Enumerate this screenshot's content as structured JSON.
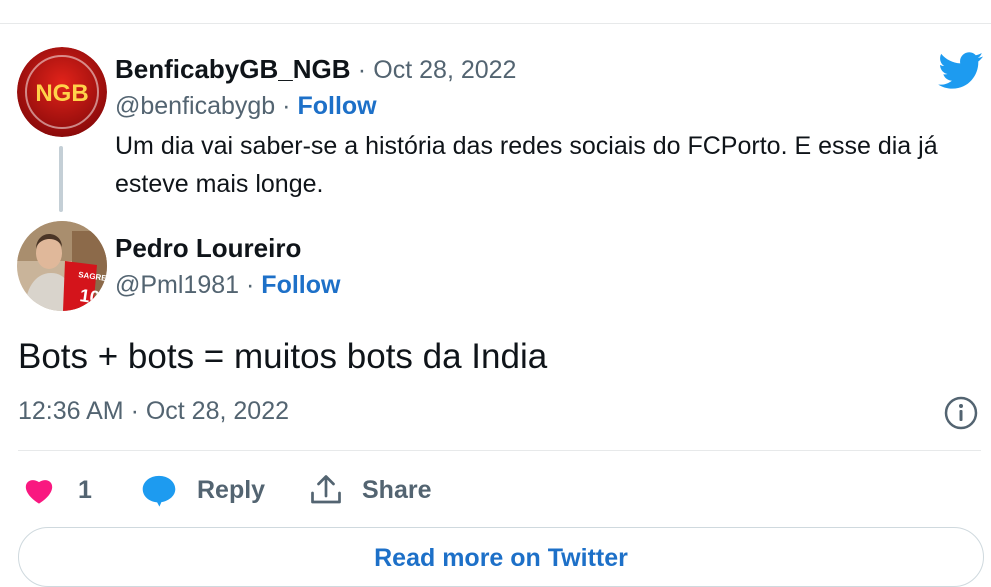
{
  "tweet_parent": {
    "author_name": "BenficabyGB_NGB",
    "separator": "·",
    "date": "Oct 28, 2022",
    "handle": "@benficabygb",
    "follow_label": "Follow",
    "text": "Um dia vai saber-se a história das redes sociais do FCPorto. E esse dia já esteve mais longe.",
    "avatar_logo_text": "NGB"
  },
  "tweet_main": {
    "author_name": "Pedro Loureiro",
    "handle": "@Pml1981",
    "separator": "·",
    "follow_label": "Follow",
    "text": "Bots + bots = muitos bots da India",
    "timestamp": "12:36 AM · Oct 28, 2022"
  },
  "actions": {
    "like_count": "1",
    "reply_label": "Reply",
    "share_label": "Share"
  },
  "footer": {
    "read_more_label": "Read more on Twitter"
  },
  "icons": {
    "brand": "twitter-bird-icon",
    "info": "info-icon",
    "like": "heart-icon",
    "reply": "speech-bubble-icon",
    "share": "share-upload-icon"
  },
  "colors": {
    "twitter_blue": "#1d9bf0",
    "link_blue": "#1d70c8",
    "like_pink": "#f91880",
    "muted_text": "#536471"
  }
}
